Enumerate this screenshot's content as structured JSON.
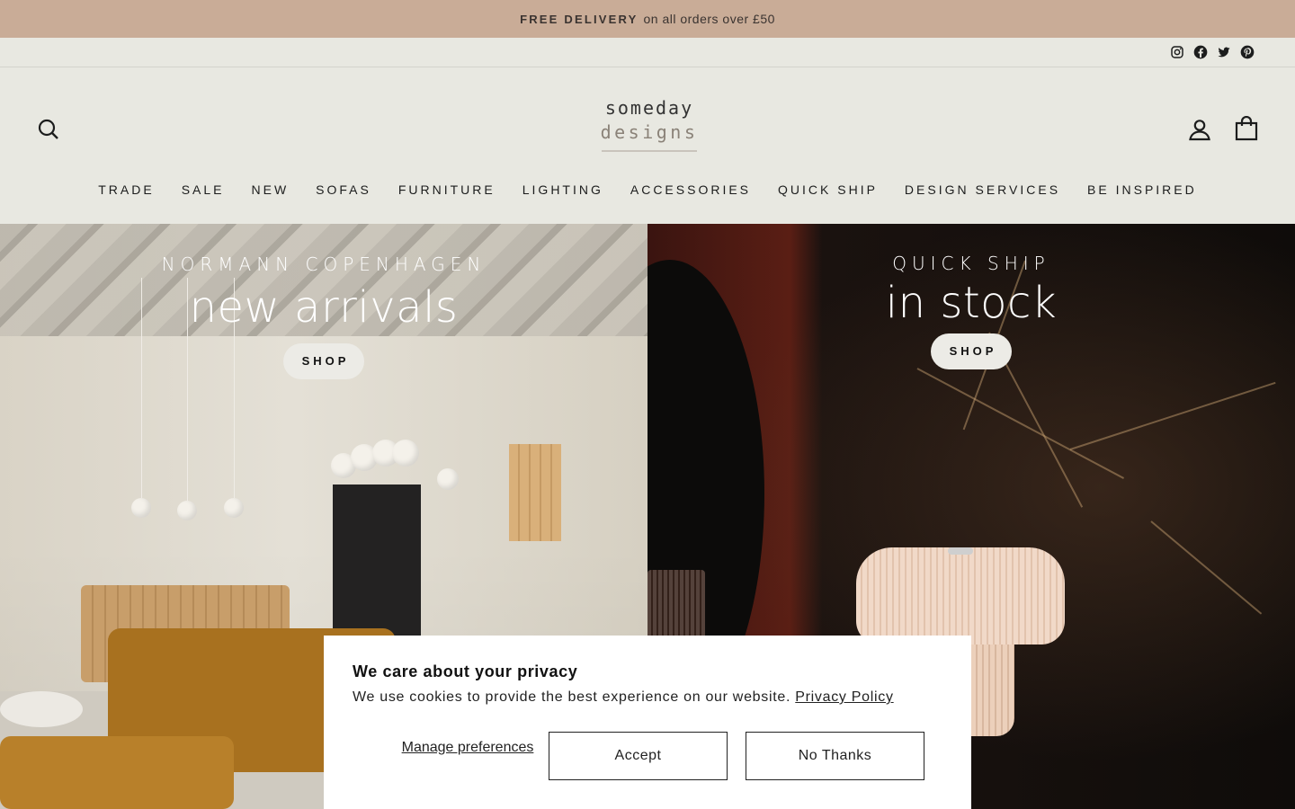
{
  "announcement": {
    "bold": "FREE DELIVERY",
    "text": "on all orders over £50"
  },
  "social": [
    "instagram-icon",
    "facebook-icon",
    "twitter-icon",
    "pinterest-icon"
  ],
  "logo": {
    "line1": "someday",
    "line2": "designs"
  },
  "nav": [
    "TRADE",
    "SALE",
    "NEW",
    "SOFAS",
    "FURNITURE",
    "LIGHTING",
    "ACCESSORIES",
    "QUICK SHIP",
    "DESIGN SERVICES",
    "BE INSPIRED"
  ],
  "hero": {
    "left": {
      "subtitle": "NORMANN COPENHAGEN",
      "title": "new arrivals",
      "button": "SHOP"
    },
    "right": {
      "subtitle": "QUICK SHIP",
      "title": "in stock",
      "button": "SHOP"
    }
  },
  "cookie": {
    "title": "We care about your privacy",
    "text": "We use cookies to provide the best experience on our website.",
    "link": "Privacy Policy",
    "manage": "Manage preferences",
    "accept": "Accept",
    "decline": "No Thanks"
  },
  "colors": {
    "announcement_bg": "#c9ac97",
    "header_bg": "#e8e8e1",
    "button_bg": "#ecebe6"
  }
}
